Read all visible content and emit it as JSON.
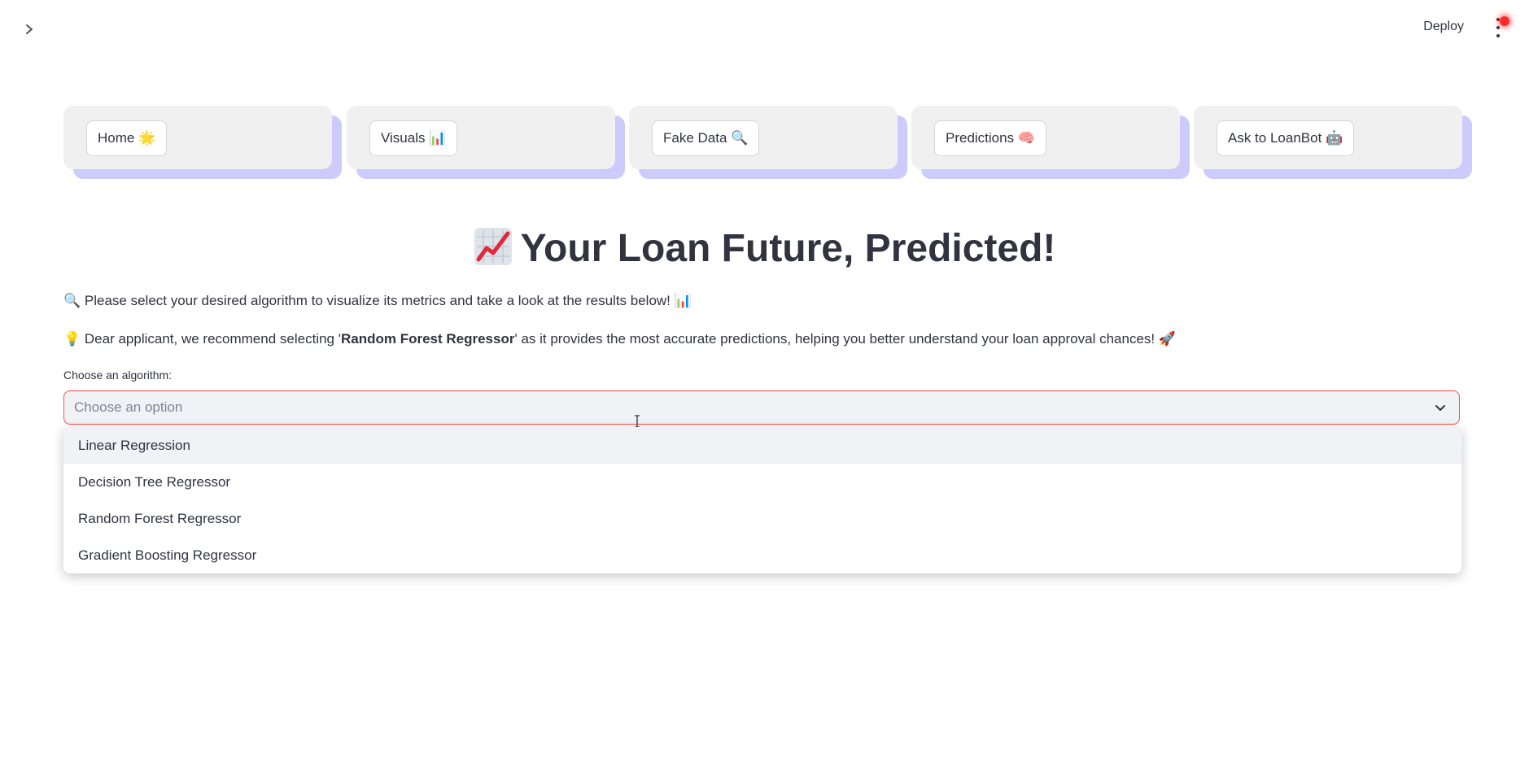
{
  "header": {
    "deploy_label": "Deploy"
  },
  "nav": {
    "items": [
      {
        "label": "Home 🌟"
      },
      {
        "label": "Visuals 📊"
      },
      {
        "label": "Fake Data 🔍"
      },
      {
        "label": "Predictions 🧠"
      },
      {
        "label": "Ask to LoanBot 🤖"
      }
    ]
  },
  "main": {
    "title": "Your Loan Future, Predicted!",
    "intro": "🔍 Please select your desired algorithm to visualize its metrics and take a look at the results below! 📊",
    "rec_prefix": "💡 Dear applicant, we recommend selecting '",
    "rec_bold": "Random Forest Regressor",
    "rec_suffix": "' as it provides the most accurate predictions, helping you better understand your loan approval chances! 🚀"
  },
  "algorithm_select": {
    "label": "Choose an algorithm:",
    "placeholder": "Choose an option",
    "options": [
      "Linear Regression",
      "Decision Tree Regressor",
      "Random Forest Regressor",
      "Gradient Boosting Regressor"
    ]
  },
  "colors": {
    "accent": "#ff4b4b",
    "nav_shadow": "#cccbfb",
    "card_bg": "#f0f0f0",
    "text": "#31333f"
  }
}
